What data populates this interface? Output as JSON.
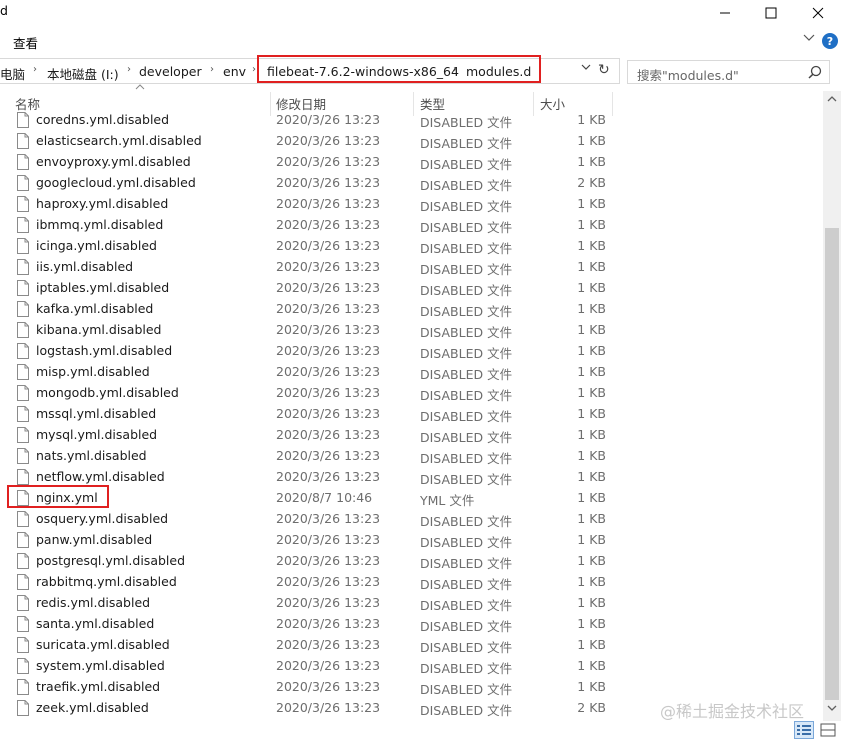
{
  "window": {
    "title": "d",
    "minimize_glyph": "─",
    "maximize_glyph": "☐",
    "close_glyph": "✕"
  },
  "ribbon": {
    "tab_view": "查看"
  },
  "address": {
    "crumbs": [
      "电脑",
      "本地磁盘 (I:)",
      "developer",
      "env",
      "filebeat-7.6.2-windows-x86_64",
      "modules.d"
    ],
    "separator": "›"
  },
  "search": {
    "placeholder": "搜索\"modules.d\""
  },
  "columns": {
    "name": "名称",
    "date": "修改日期",
    "type": "类型",
    "size": "大小"
  },
  "files": [
    {
      "name": "coredns.yml.disabled",
      "date": "2020/3/26 13:23",
      "type": "DISABLED 文件",
      "size": "1 KB"
    },
    {
      "name": "elasticsearch.yml.disabled",
      "date": "2020/3/26 13:23",
      "type": "DISABLED 文件",
      "size": "1 KB"
    },
    {
      "name": "envoyproxy.yml.disabled",
      "date": "2020/3/26 13:23",
      "type": "DISABLED 文件",
      "size": "1 KB"
    },
    {
      "name": "googlecloud.yml.disabled",
      "date": "2020/3/26 13:23",
      "type": "DISABLED 文件",
      "size": "2 KB"
    },
    {
      "name": "haproxy.yml.disabled",
      "date": "2020/3/26 13:23",
      "type": "DISABLED 文件",
      "size": "1 KB"
    },
    {
      "name": "ibmmq.yml.disabled",
      "date": "2020/3/26 13:23",
      "type": "DISABLED 文件",
      "size": "1 KB"
    },
    {
      "name": "icinga.yml.disabled",
      "date": "2020/3/26 13:23",
      "type": "DISABLED 文件",
      "size": "1 KB"
    },
    {
      "name": "iis.yml.disabled",
      "date": "2020/3/26 13:23",
      "type": "DISABLED 文件",
      "size": "1 KB"
    },
    {
      "name": "iptables.yml.disabled",
      "date": "2020/3/26 13:23",
      "type": "DISABLED 文件",
      "size": "1 KB"
    },
    {
      "name": "kafka.yml.disabled",
      "date": "2020/3/26 13:23",
      "type": "DISABLED 文件",
      "size": "1 KB"
    },
    {
      "name": "kibana.yml.disabled",
      "date": "2020/3/26 13:23",
      "type": "DISABLED 文件",
      "size": "1 KB"
    },
    {
      "name": "logstash.yml.disabled",
      "date": "2020/3/26 13:23",
      "type": "DISABLED 文件",
      "size": "1 KB"
    },
    {
      "name": "misp.yml.disabled",
      "date": "2020/3/26 13:23",
      "type": "DISABLED 文件",
      "size": "1 KB"
    },
    {
      "name": "mongodb.yml.disabled",
      "date": "2020/3/26 13:23",
      "type": "DISABLED 文件",
      "size": "1 KB"
    },
    {
      "name": "mssql.yml.disabled",
      "date": "2020/3/26 13:23",
      "type": "DISABLED 文件",
      "size": "1 KB"
    },
    {
      "name": "mysql.yml.disabled",
      "date": "2020/3/26 13:23",
      "type": "DISABLED 文件",
      "size": "1 KB"
    },
    {
      "name": "nats.yml.disabled",
      "date": "2020/3/26 13:23",
      "type": "DISABLED 文件",
      "size": "1 KB"
    },
    {
      "name": "netflow.yml.disabled",
      "date": "2020/3/26 13:23",
      "type": "DISABLED 文件",
      "size": "1 KB"
    },
    {
      "name": "nginx.yml",
      "date": "2020/8/7 10:46",
      "type": "YML 文件",
      "size": "1 KB"
    },
    {
      "name": "osquery.yml.disabled",
      "date": "2020/3/26 13:23",
      "type": "DISABLED 文件",
      "size": "1 KB"
    },
    {
      "name": "panw.yml.disabled",
      "date": "2020/3/26 13:23",
      "type": "DISABLED 文件",
      "size": "1 KB"
    },
    {
      "name": "postgresql.yml.disabled",
      "date": "2020/3/26 13:23",
      "type": "DISABLED 文件",
      "size": "1 KB"
    },
    {
      "name": "rabbitmq.yml.disabled",
      "date": "2020/3/26 13:23",
      "type": "DISABLED 文件",
      "size": "1 KB"
    },
    {
      "name": "redis.yml.disabled",
      "date": "2020/3/26 13:23",
      "type": "DISABLED 文件",
      "size": "1 KB"
    },
    {
      "name": "santa.yml.disabled",
      "date": "2020/3/26 13:23",
      "type": "DISABLED 文件",
      "size": "1 KB"
    },
    {
      "name": "suricata.yml.disabled",
      "date": "2020/3/26 13:23",
      "type": "DISABLED 文件",
      "size": "1 KB"
    },
    {
      "name": "system.yml.disabled",
      "date": "2020/3/26 13:23",
      "type": "DISABLED 文件",
      "size": "1 KB"
    },
    {
      "name": "traefik.yml.disabled",
      "date": "2020/3/26 13:23",
      "type": "DISABLED 文件",
      "size": "1 KB"
    },
    {
      "name": "zeek.yml.disabled",
      "date": "2020/3/26 13:23",
      "type": "DISABLED 文件",
      "size": "2 KB"
    }
  ],
  "watermark": "@稀土掘金技术社区",
  "colors": {
    "highlight": "#e02020",
    "help_blue": "#1f6fc5"
  }
}
